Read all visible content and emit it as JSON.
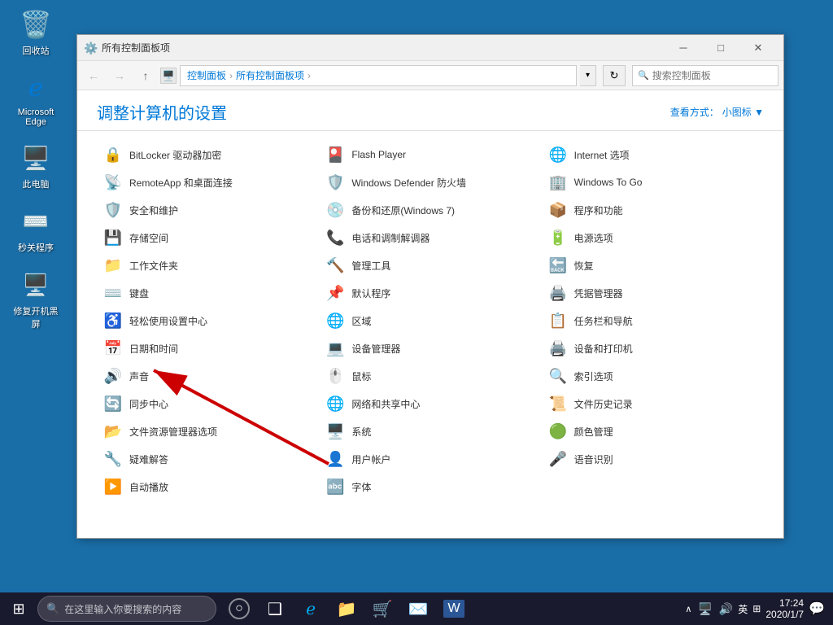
{
  "desktop": {
    "icons": [
      {
        "id": "recycle-bin",
        "label": "回收站",
        "icon": "🗑️"
      },
      {
        "id": "edge",
        "label": "Microsoft Edge",
        "icon": "📘"
      },
      {
        "id": "this-pc",
        "label": "此电脑",
        "icon": "💻"
      },
      {
        "id": "shortcuts",
        "label": "秒关程序",
        "icon": "⌨️"
      },
      {
        "id": "repair",
        "label": "修复开机黑屏",
        "icon": "🖥️"
      }
    ]
  },
  "window": {
    "title": "所有控制面板项",
    "titlebar_buttons": {
      "minimize": "─",
      "maximize": "□",
      "close": "✕"
    }
  },
  "addressbar": {
    "back_label": "←",
    "forward_label": "→",
    "up_label": "↑",
    "breadcrumb": [
      {
        "label": "控制面板",
        "active": true
      },
      {
        "label": "所有控制面板项",
        "active": true
      }
    ],
    "refresh_label": "↻",
    "search_placeholder": "搜索控制面板"
  },
  "content": {
    "heading": "调整计算机的设置",
    "view_mode_label": "查看方式：",
    "view_mode_value": "小图标 ▼",
    "items": [
      {
        "col": 0,
        "icon": "🔒",
        "label": "BitLocker 驱动器加密"
      },
      {
        "col": 0,
        "icon": "📡",
        "label": "RemoteApp 和桌面连接"
      },
      {
        "col": 0,
        "icon": "🛡️",
        "label": "安全和维护"
      },
      {
        "col": 0,
        "icon": "💾",
        "label": "存储空间"
      },
      {
        "col": 0,
        "icon": "📁",
        "label": "工作文件夹"
      },
      {
        "col": 0,
        "icon": "⌨️",
        "label": "键盘"
      },
      {
        "col": 0,
        "icon": "♿",
        "label": "轻松使用设置中心"
      },
      {
        "col": 0,
        "icon": "📅",
        "label": "日期和时间"
      },
      {
        "col": 0,
        "icon": "🔊",
        "label": "声音"
      },
      {
        "col": 0,
        "icon": "🔄",
        "label": "同步中心"
      },
      {
        "col": 0,
        "icon": "📂",
        "label": "文件资源管理器选项"
      },
      {
        "col": 0,
        "icon": "🔧",
        "label": "疑难解答"
      },
      {
        "col": 0,
        "icon": "▶️",
        "label": "自动播放"
      },
      {
        "col": 1,
        "icon": "🎴",
        "label": "Flash Player"
      },
      {
        "col": 1,
        "icon": "🛡️",
        "label": "Windows Defender 防火墙"
      },
      {
        "col": 1,
        "icon": "💿",
        "label": "备份和还原(Windows 7)"
      },
      {
        "col": 1,
        "icon": "📞",
        "label": "电话和调制解调器"
      },
      {
        "col": 1,
        "icon": "🔨",
        "label": "管理工具"
      },
      {
        "col": 1,
        "icon": "📌",
        "label": "默认程序"
      },
      {
        "col": 1,
        "icon": "🌐",
        "label": "区域"
      },
      {
        "col": 1,
        "icon": "💻",
        "label": "设备管理器"
      },
      {
        "col": 1,
        "icon": "🖱️",
        "label": "鼠标"
      },
      {
        "col": 1,
        "icon": "🌐",
        "label": "网络和共享中心"
      },
      {
        "col": 1,
        "icon": "🖥️",
        "label": "系统"
      },
      {
        "col": 1,
        "icon": "👤",
        "label": "用户帐户"
      },
      {
        "col": 1,
        "icon": "🔤",
        "label": "字体"
      },
      {
        "col": 2,
        "icon": "🌐",
        "label": "Internet 选项"
      },
      {
        "col": 2,
        "icon": "🏢",
        "label": "Windows To Go"
      },
      {
        "col": 2,
        "icon": "📦",
        "label": "程序和功能"
      },
      {
        "col": 2,
        "icon": "🔋",
        "label": "电源选项"
      },
      {
        "col": 2,
        "icon": "🔙",
        "label": "恢复"
      },
      {
        "col": 2,
        "icon": "🖨️",
        "label": "凭据管理器"
      },
      {
        "col": 2,
        "icon": "📋",
        "label": "任务栏和导航"
      },
      {
        "col": 2,
        "icon": "🖨️",
        "label": "设备和打印机"
      },
      {
        "col": 2,
        "icon": "🔍",
        "label": "索引选项"
      },
      {
        "col": 2,
        "icon": "📜",
        "label": "文件历史记录"
      },
      {
        "col": 2,
        "icon": "🟢",
        "label": "颜色管理"
      },
      {
        "col": 2,
        "icon": "🎤",
        "label": "语音识别"
      }
    ]
  },
  "taskbar": {
    "start_icon": "⊞",
    "search_placeholder": "在这里输入你要搜索的内容",
    "task_icons": [
      "○",
      "❑",
      "e",
      "📁",
      "🛒",
      "✉️",
      "W"
    ],
    "sys_icons": [
      "🔺",
      "📢",
      "英",
      "⊞"
    ],
    "time": "17:24",
    "date": "2020/1/7",
    "notification_icon": "💬"
  }
}
